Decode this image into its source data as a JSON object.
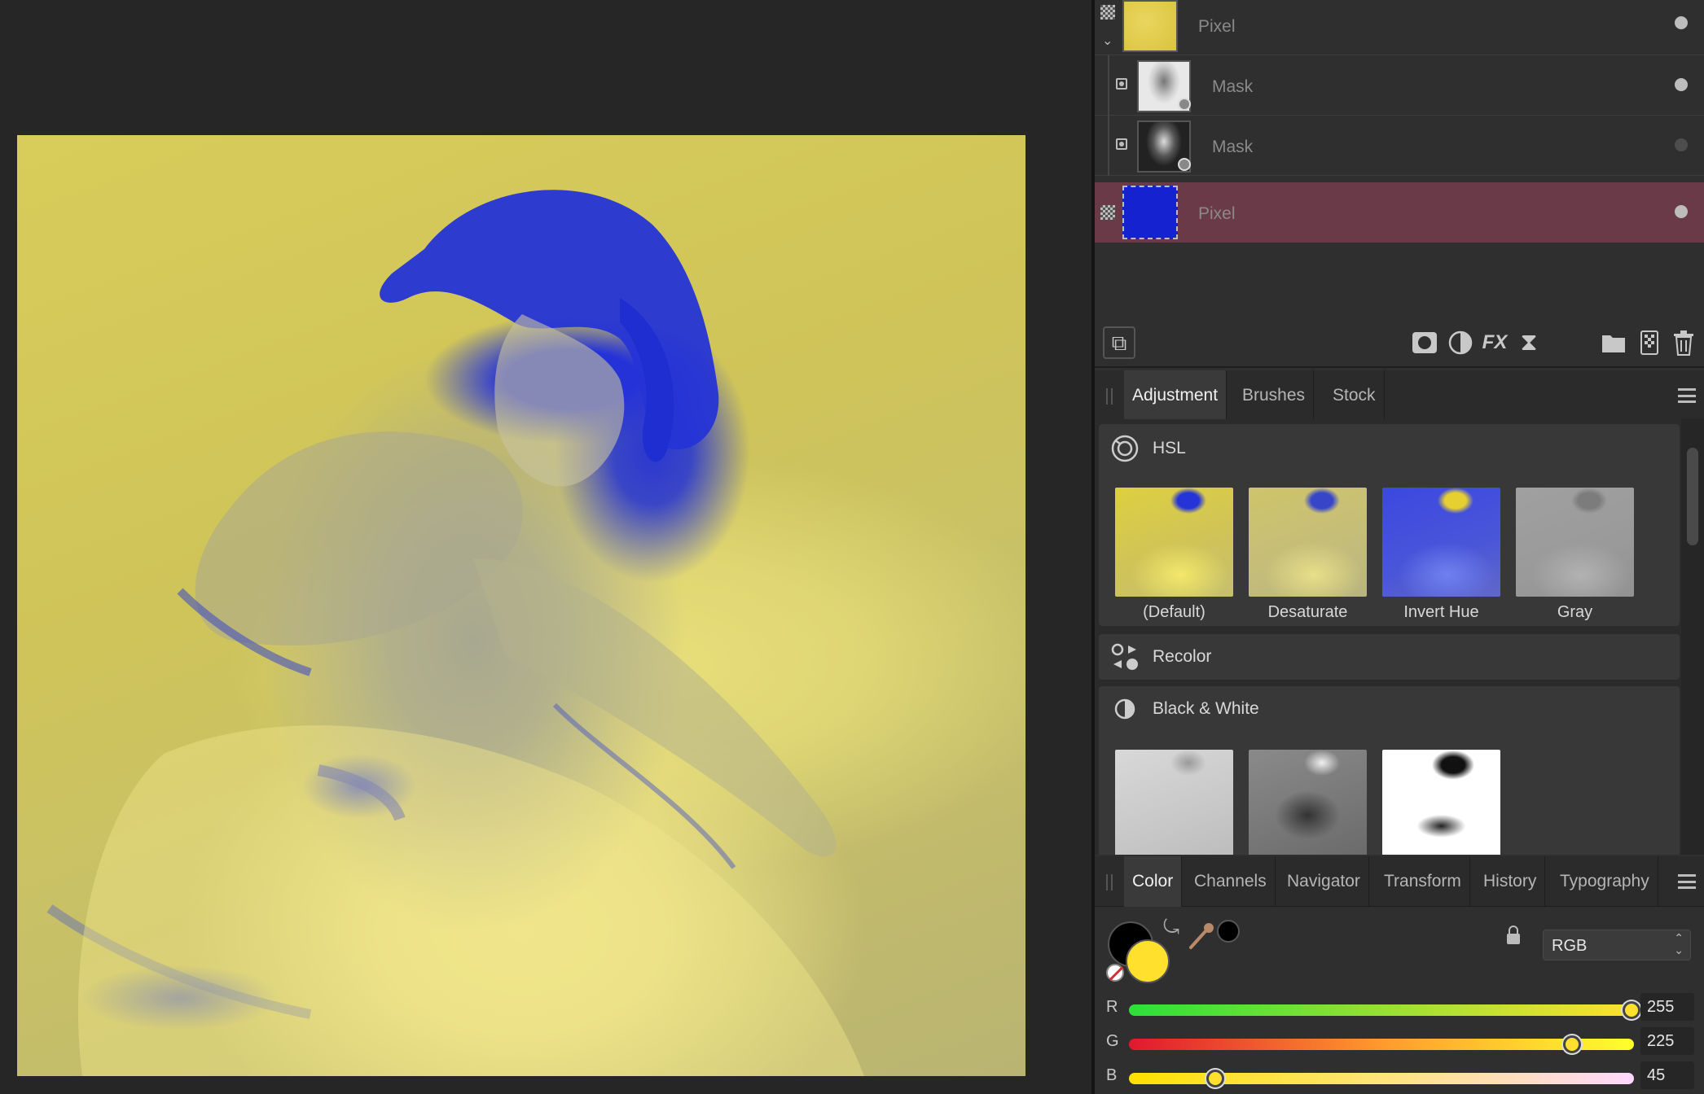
{
  "layers": [
    {
      "name": "Pixel",
      "type": "pixel",
      "thumb_color": "#e3cf45",
      "visible": true,
      "selected": false
    },
    {
      "name": "Mask",
      "type": "mask",
      "visible": true,
      "selected": false
    },
    {
      "name": "Mask",
      "type": "mask",
      "visible": false,
      "selected": false
    },
    {
      "name": "Pixel",
      "type": "pixel",
      "thumb_color": "#1422d0",
      "visible": true,
      "selected": true
    }
  ],
  "layers_toolbar": {
    "icons": [
      "layers-icon",
      "mask-icon",
      "adjustment-icon",
      "fx-icon",
      "live-filter-icon",
      "group-icon",
      "pixel-layer-icon",
      "trash-icon"
    ]
  },
  "studio_tabs_top": {
    "tabs": [
      "Adjustment",
      "Brushes",
      "Stock"
    ],
    "active": "Adjustment"
  },
  "adjustments": {
    "groups": [
      {
        "title": "HSL",
        "presets": [
          "(Default)",
          "Desaturate",
          "Invert Hue",
          "Gray"
        ]
      },
      {
        "title": "Recolor",
        "presets": []
      },
      {
        "title": "Black & White",
        "presets": [
          "",
          "",
          ""
        ]
      }
    ]
  },
  "studio_tabs_bottom": {
    "tabs": [
      "Color",
      "Channels",
      "Navigator",
      "Transform",
      "History",
      "Typography"
    ],
    "active": "Color"
  },
  "color": {
    "primary": "#000000",
    "secondary": "#ffe12d",
    "model": "RGB",
    "channels": [
      {
        "label": "R",
        "value": "255",
        "fraction": 1.0
      },
      {
        "label": "G",
        "value": "225",
        "fraction": 0.882
      },
      {
        "label": "B",
        "value": "45",
        "fraction": 0.176
      }
    ]
  }
}
